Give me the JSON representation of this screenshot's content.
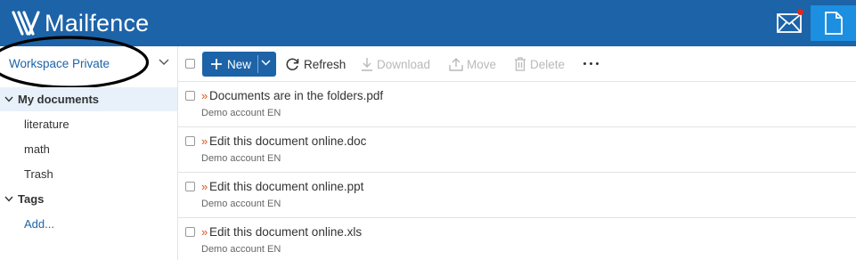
{
  "header": {
    "brand_name": "Mailfence",
    "brand_color": "#1d63a8",
    "mail_icon": "envelope-icon",
    "docs_icon": "document-icon",
    "has_unread_notification": true
  },
  "sidebar": {
    "workspace": "Workspace Private",
    "sections": [
      {
        "label": "My documents",
        "expanded": true,
        "selected": true,
        "items": [
          "literature",
          "math",
          "Trash"
        ]
      },
      {
        "label": "Tags",
        "expanded": true,
        "items": []
      }
    ],
    "add_tag_label": "Add..."
  },
  "toolbar": {
    "new_label": "New",
    "refresh_label": "Refresh",
    "download_label": "Download",
    "move_label": "Move",
    "delete_label": "Delete",
    "more_icon": "more-horizontal-icon",
    "disabled_actions": [
      "Download",
      "Move",
      "Delete"
    ]
  },
  "files": [
    {
      "name": "Documents are in the folders.pdf",
      "owner": "Demo account EN"
    },
    {
      "name": "Edit this document online.doc",
      "owner": "Demo account EN"
    },
    {
      "name": "Edit this document online.ppt",
      "owner": "Demo account EN"
    },
    {
      "name": "Edit this document online.xls",
      "owner": "Demo account EN"
    }
  ],
  "file_marker": "»"
}
